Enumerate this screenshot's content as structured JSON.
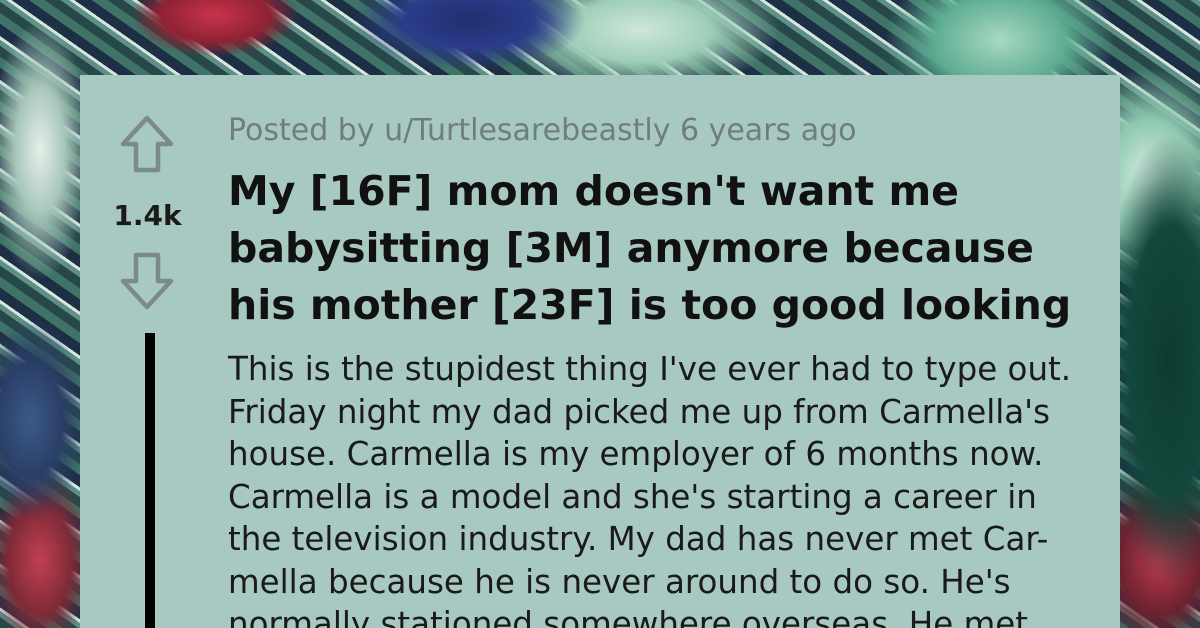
{
  "post": {
    "meta": "Posted by u/Turtlesarebeastly 6 years ago",
    "score": "1.4k",
    "title_lines": [
      "My [16F] mom doesn't want me",
      "babysitting [3M] anymore because",
      "his mother [23F] is too good looking"
    ],
    "body_lines": [
      "This is the stupidest thing I've ever had to type out.",
      "Friday night my dad picked me up from Carmella's",
      "house. Carmella is my employer of 6 months now.",
      "Carmella is a model and she's starting a career in",
      "the television industry. My dad has never met Car-",
      "mella because he is never around to do so. He's",
      "normally stationed somewhere overseas. He met"
    ]
  },
  "icons": {
    "upvote": "upvote-arrow-icon",
    "downvote": "downvote-arrow-icon"
  },
  "colors": {
    "card": "#a8c9c1",
    "meta_text": "#6f7e7a",
    "arrow_stroke": "#7d8b88"
  }
}
